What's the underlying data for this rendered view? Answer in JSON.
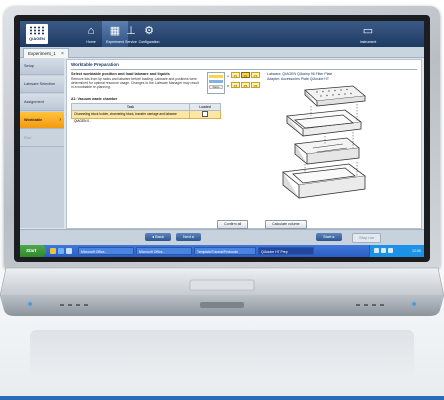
{
  "app": {
    "logo_text": "QIAGEN",
    "nav": [
      {
        "label": "Home",
        "icon": "home-icon"
      },
      {
        "label": "Experiment",
        "icon": "experiment-grid-icon"
      },
      {
        "label": "Service",
        "icon": "service-icon"
      },
      {
        "label": "Configuration",
        "icon": "configuration-icon"
      }
    ],
    "tools_label": "Instrument",
    "document_tab": "Experiment_1"
  },
  "sidebar": {
    "items": [
      {
        "label": "Setup",
        "state": "normal"
      },
      {
        "label": "Labware Selection",
        "state": "normal"
      },
      {
        "label": "Assignment",
        "state": "normal"
      },
      {
        "label": "Worktable",
        "state": "active"
      },
      {
        "label": "Run",
        "state": "disabled"
      }
    ]
  },
  "main": {
    "title": "Worktable Preparation",
    "instruction_heading": "Select worktable position and load labware and liquids",
    "instruction_text": "Remove lids from tip racks and labware before loading. Labware and positions were determined for optimal resource usage. Changes to the Labware Manager may result in a worktable re-planning.",
    "legend_waste": "Waste",
    "grid": {
      "row_labels": [
        "A",
        "B"
      ],
      "slots": [
        "P1",
        "P2",
        "P3",
        "P4",
        "P5",
        "P6"
      ],
      "selected": "P2"
    },
    "status_title": "A1: Vacuum waste chamber",
    "table": {
      "headers": [
        "Task",
        "Loaded"
      ],
      "rows": [
        {
          "task": "Channeling block holder, channeling block, transfer carriage and labware QIAGEN 0.."
        }
      ]
    },
    "labware_info": [
      "Labware: QIAGEN QIAamp 96 Filter Plate",
      "Adapter: Accessories Plate QIAcube HT"
    ],
    "confirm_all": "Confirm all",
    "calculate_volume": "Calculate volume"
  },
  "navbar": {
    "back": "Back",
    "next": "Next",
    "start": "Start",
    "stop": "Stop run"
  },
  "taskbar": {
    "start": "Start",
    "items": [
      "Microsoft Office...",
      "Microsoft Office...",
      "Template/Tutorial/Protocols",
      "QIAcube HT Prep"
    ],
    "time": "12:00"
  },
  "colors": {
    "accent_orange": "#f39a12",
    "header_blue": "#1e3a62",
    "slot_yellow": "#ffd24a"
  }
}
